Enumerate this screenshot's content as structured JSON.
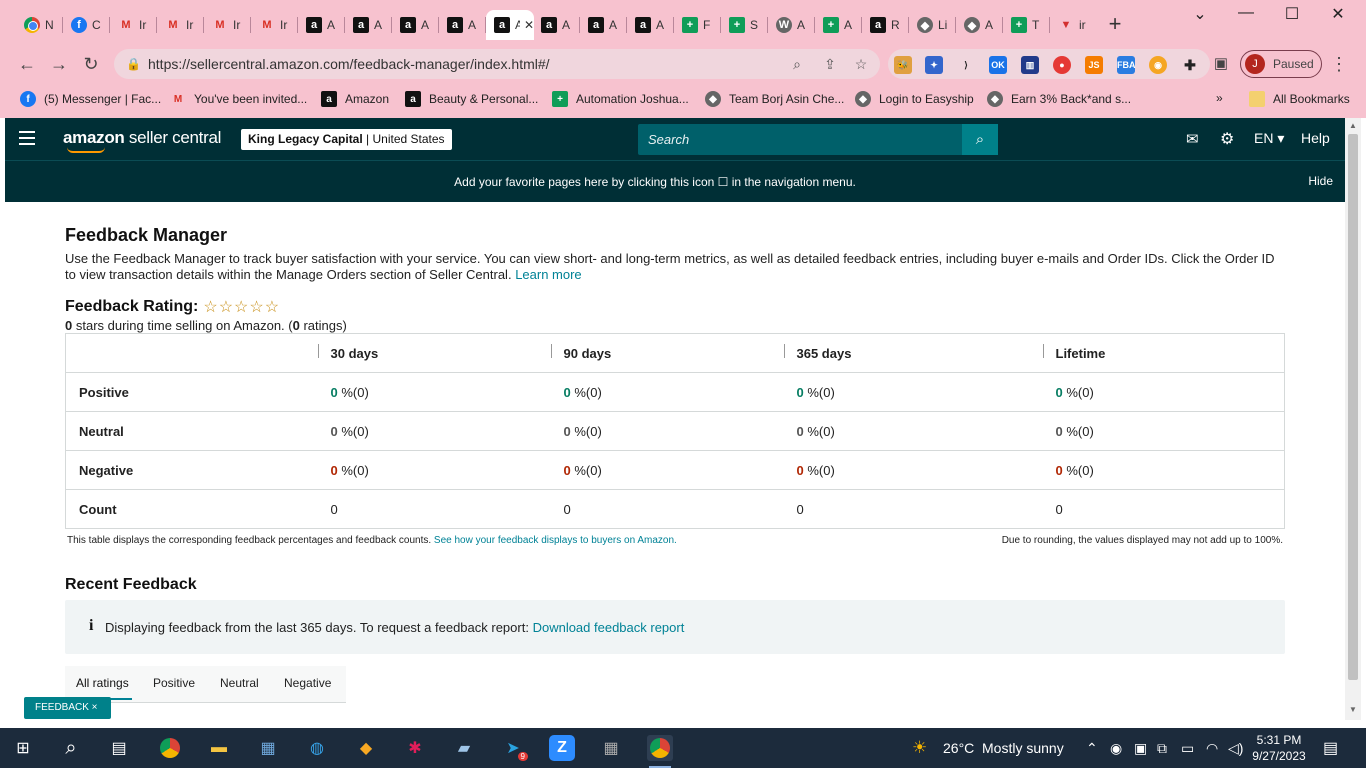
{
  "browser": {
    "tabs": [
      {
        "icon": "chrome-icon",
        "label": "N"
      },
      {
        "icon": "facebook-icon",
        "label": "C"
      },
      {
        "icon": "gmail-icon",
        "label": "Ir"
      },
      {
        "icon": "gmail-icon",
        "label": "Ir"
      },
      {
        "icon": "gmail-icon",
        "label": "Ir"
      },
      {
        "icon": "gmail-icon",
        "label": "Ir"
      },
      {
        "icon": "amazon-icon",
        "label": "A"
      },
      {
        "icon": "amazon-icon",
        "label": "A"
      },
      {
        "icon": "amazon-icon",
        "label": "A"
      },
      {
        "icon": "amazon-icon",
        "label": "A"
      },
      {
        "icon": "amazon-icon",
        "label": "A",
        "active": true
      },
      {
        "icon": "amazon-icon",
        "label": "A"
      },
      {
        "icon": "amazon-icon",
        "label": "A"
      },
      {
        "icon": "amazon-icon",
        "label": "A"
      },
      {
        "icon": "sheets-icon",
        "label": "F"
      },
      {
        "icon": "sheets-icon",
        "label": "S"
      },
      {
        "icon": "wordpress-icon",
        "label": "A"
      },
      {
        "icon": "sheets-icon",
        "label": "A"
      },
      {
        "icon": "amazon-icon",
        "label": "R"
      },
      {
        "icon": "app-icon",
        "label": "Li"
      },
      {
        "icon": "app-icon",
        "label": "A"
      },
      {
        "icon": "sheets-icon",
        "label": "T"
      },
      {
        "icon": "red-app-icon",
        "label": "ir"
      }
    ],
    "url": "https://sellercentral.amazon.com/feedback-manager/index.html#/",
    "profile": {
      "initial": "J",
      "status": "Paused"
    },
    "bookmarks": [
      {
        "icon": "facebook-icon",
        "label": "(5) Messenger | Fac..."
      },
      {
        "icon": "gmail-icon",
        "label": "You've been invited..."
      },
      {
        "icon": "amazon-icon",
        "label": "Amazon"
      },
      {
        "icon": "amazon-icon",
        "label": "Beauty & Personal..."
      },
      {
        "icon": "sheets-icon",
        "label": "Automation Joshua..."
      },
      {
        "icon": "app-icon",
        "label": "Team Borj Asin Che..."
      },
      {
        "icon": "app-icon",
        "label": "Login to Easyship"
      },
      {
        "icon": "app-icon",
        "label": "Earn 3% Back*and s..."
      }
    ],
    "all_bookmarks": "All Bookmarks",
    "more_bookmarks": "»"
  },
  "seller": {
    "logo_bold": "amazon",
    "logo_rest": " seller central",
    "account_name": "King Legacy Capital",
    "account_region": "United States",
    "search_placeholder": "Search",
    "lang": "EN",
    "help": "Help",
    "fav_msg": "Add your favorite pages here by clicking this icon ☐ in the navigation menu.",
    "hide": "Hide"
  },
  "page": {
    "title": "Feedback Manager",
    "description": "Use the Feedback Manager to track buyer satisfaction with your service. You can view short- and long-term metrics, as well as detailed feedback entries, including buyer e-mails and Order IDs. Click the Order ID to view transaction details within the Manage Orders section of Seller Central.",
    "learn_more": "Learn more",
    "rating_label": "Feedback Rating:",
    "stars": "☆☆☆☆☆",
    "rating_stars_value": "0",
    "rating_sub_mid": " stars during time selling on Amazon. (",
    "rating_count": "0",
    "rating_sub_end": " ratings)",
    "table": {
      "headers": [
        "30 days",
        "90 days",
        "365 days",
        "Lifetime"
      ],
      "rows": [
        {
          "label": "Positive",
          "cells": [
            {
              "v": "0",
              "r": " %(0)"
            },
            {
              "v": "0",
              "r": " %(0)"
            },
            {
              "v": "0",
              "r": " %(0)"
            },
            {
              "v": "0",
              "r": " %(0)"
            }
          ]
        },
        {
          "label": "Neutral",
          "cells": [
            {
              "v": "0",
              "r": " %(0)"
            },
            {
              "v": "0",
              "r": " %(0)"
            },
            {
              "v": "0",
              "r": " %(0)"
            },
            {
              "v": "0",
              "r": " %(0)"
            }
          ]
        },
        {
          "label": "Negative",
          "cells": [
            {
              "v": "0",
              "r": " %(0)"
            },
            {
              "v": "0",
              "r": " %(0)"
            },
            {
              "v": "0",
              "r": " %(0)"
            },
            {
              "v": "0",
              "r": " %(0)"
            }
          ]
        },
        {
          "label": "Count",
          "cells": [
            {
              "v": "0"
            },
            {
              "v": "0"
            },
            {
              "v": "0"
            },
            {
              "v": "0"
            }
          ]
        }
      ]
    },
    "footnote_left": "This table displays the corresponding feedback percentages and feedback counts.",
    "footnote_link": "See how your feedback displays to buyers on Amazon.",
    "footnote_right": "Due to rounding, the values displayed may not add up to 100%.",
    "recent_title": "Recent Feedback",
    "info_text": "Displaying feedback from the last 365 days. To request a feedback report:",
    "info_link": "Download feedback report",
    "filter_tabs": [
      "All ratings",
      "Positive",
      "Neutral",
      "Negative"
    ],
    "feedback_button": "FEEDBACK ×"
  },
  "taskbar": {
    "weather_temp": "26°C",
    "weather_desc": "Mostly sunny",
    "time": "5:31 PM",
    "date": "9/27/2023",
    "telegram_badge": "9"
  },
  "colors": {
    "chrome_bg": "#f7c2cf",
    "seller_nav": "#002f36",
    "teal_link": "#008296",
    "positive": "#067d62",
    "negative": "#b12704"
  }
}
